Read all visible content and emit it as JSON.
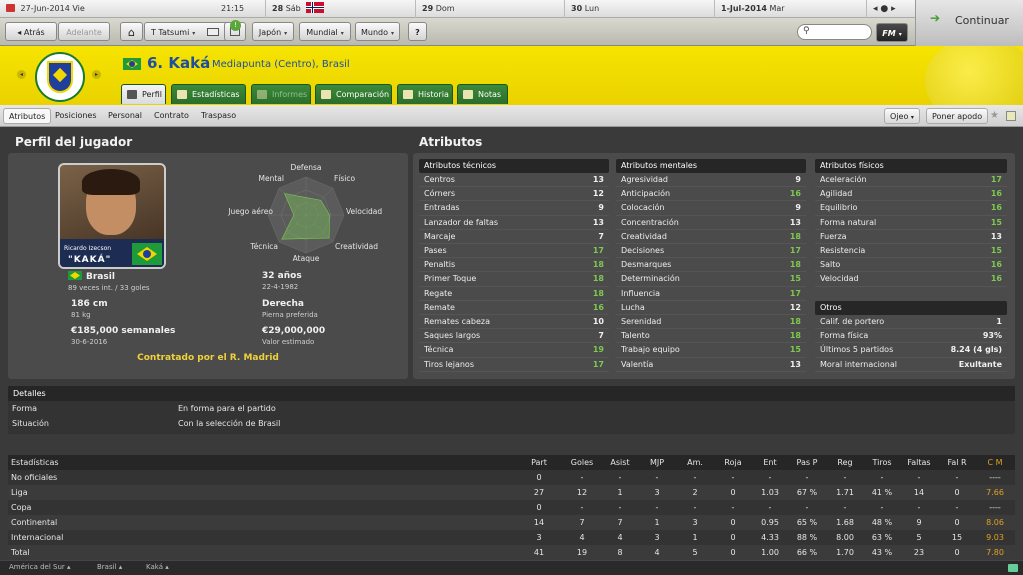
{
  "calendar": {
    "date": "27-Jun-2014",
    "weekday": "Vie",
    "time": "21:15",
    "days": [
      {
        "num": "28",
        "name": "Sáb"
      },
      {
        "num": "29",
        "name": "Dom"
      },
      {
        "num": "30",
        "name": "Lun"
      },
      {
        "num": "1-Jul-2014",
        "name": "Mar"
      }
    ]
  },
  "toolbar": {
    "back": "Atrás",
    "forward": "Adelante",
    "manager": "T Tatsumi",
    "menus": [
      "Japón",
      "Mundial",
      "Mundo"
    ],
    "help": "?",
    "continue": "Continuar",
    "fm": "FM"
  },
  "player": {
    "number_name": "6. Kaká",
    "position": "Mediapunta (Centro), Brasil",
    "card_name": "Ricardo Izecson",
    "card_nick": "\"KAKÁ\""
  },
  "tabs": [
    {
      "label": "Perfil",
      "active": true,
      "disabled": false
    },
    {
      "label": "Estadísticas",
      "active": false,
      "disabled": false
    },
    {
      "label": "Informes",
      "active": false,
      "disabled": true
    },
    {
      "label": "Comparación",
      "active": false,
      "disabled": false
    },
    {
      "label": "Historia",
      "active": false,
      "disabled": false
    },
    {
      "label": "Notas",
      "active": false,
      "disabled": false
    }
  ],
  "subnav": {
    "items": [
      "Atributos",
      "Posiciones",
      "Personal",
      "Contrato",
      "Traspaso"
    ],
    "ojeo": "Ojeo",
    "nickname": "Poner apodo"
  },
  "profile": {
    "title": "Perfil del jugador",
    "radar_labels": {
      "defensa": "Defensa",
      "fisico": "Físico",
      "velocidad": "Velocidad",
      "creatividad": "Creatividad",
      "ataque": "Ataque",
      "tecnica": "Técnica",
      "juego_aereo": "Juego aéreo",
      "mental": "Mental"
    },
    "radar_values": [
      0.46,
      0.55,
      0.62,
      0.86,
      0.62,
      0.9,
      0.32,
      0.8
    ],
    "info": [
      {
        "title": "Brasil",
        "sub": "89 veces int. / 33 goles"
      },
      {
        "title": "32 años",
        "sub": "22-4-1982"
      },
      {
        "title": "186 cm",
        "sub": "81 kg"
      },
      {
        "title": "Derecha",
        "sub": "Pierna preferida"
      },
      {
        "title": "€185,000 semanales",
        "sub": "30-6-2016"
      },
      {
        "title": "€29,000,000",
        "sub": "Valor estimado"
      }
    ],
    "contract": "Contratado por el R. Madrid"
  },
  "attributes": {
    "title": "Atributos",
    "technical": {
      "header": "Atributos técnicos",
      "rows": [
        [
          "Centros",
          13
        ],
        [
          "Córners",
          12
        ],
        [
          "Entradas",
          9
        ],
        [
          "Lanzador de faltas",
          13
        ],
        [
          "Marcaje",
          7
        ],
        [
          "Pases",
          17
        ],
        [
          "Penaltis",
          18
        ],
        [
          "Primer Toque",
          18
        ],
        [
          "Regate",
          18
        ],
        [
          "Remate",
          16
        ],
        [
          "Remates cabeza",
          10
        ],
        [
          "Saques largos",
          7
        ],
        [
          "Técnica",
          19
        ],
        [
          "Tiros lejanos",
          17
        ]
      ]
    },
    "mental": {
      "header": "Atributos mentales",
      "rows": [
        [
          "Agresividad",
          9
        ],
        [
          "Anticipación",
          16
        ],
        [
          "Colocación",
          9
        ],
        [
          "Concentración",
          13
        ],
        [
          "Creatividad",
          18
        ],
        [
          "Decisiones",
          17
        ],
        [
          "Desmarques",
          18
        ],
        [
          "Determinación",
          15
        ],
        [
          "Influencia",
          17
        ],
        [
          "Lucha",
          12
        ],
        [
          "Serenidad",
          18
        ],
        [
          "Talento",
          18
        ],
        [
          "Trabajo equipo",
          15
        ],
        [
          "Valentía",
          13
        ]
      ]
    },
    "physical": {
      "header": "Atributos físicos",
      "rows": [
        [
          "Aceleración",
          17
        ],
        [
          "Agilidad",
          16
        ],
        [
          "Equilibrio",
          16
        ],
        [
          "Forma natural",
          15
        ],
        [
          "Fuerza",
          13
        ],
        [
          "Resistencia",
          15
        ],
        [
          "Salto",
          16
        ],
        [
          "Velocidad",
          16
        ]
      ]
    },
    "others": {
      "header": "Otros",
      "rows": [
        [
          "Calif. de portero",
          "1"
        ],
        [
          "Forma física",
          "93%"
        ],
        [
          "Últimos 5 partidos",
          "8.24 (4 gls)"
        ],
        [
          "Moral internacional",
          "Exultante"
        ]
      ]
    }
  },
  "details": {
    "header": "Detalles",
    "rows": [
      [
        "Forma",
        "En forma para el partido"
      ],
      [
        "Situación",
        "Con la selección de Brasil"
      ]
    ]
  },
  "stats": {
    "headers": [
      "Estadísticas",
      "Part",
      "Goles",
      "Asist",
      "MJP",
      "Am.",
      "Roja",
      "Ent",
      "Pas P",
      "Reg",
      "Tiros",
      "Faltas",
      "Fal R",
      "C M"
    ],
    "rows": [
      [
        "No oficiales",
        "0",
        "-",
        "-",
        "-",
        "-",
        "-",
        "-",
        "-",
        "-",
        "-",
        "-",
        "-",
        "----"
      ],
      [
        "Liga",
        "27",
        "12",
        "1",
        "3",
        "2",
        "0",
        "1.03",
        "67 %",
        "1.71",
        "41 %",
        "14",
        "0",
        "7.66"
      ],
      [
        "Copa",
        "0",
        "-",
        "-",
        "-",
        "-",
        "-",
        "-",
        "-",
        "-",
        "-",
        "-",
        "-",
        "----"
      ],
      [
        "Continental",
        "14",
        "7",
        "7",
        "1",
        "3",
        "0",
        "0.95",
        "65 %",
        "1.68",
        "48 %",
        "9",
        "0",
        "8.06"
      ],
      [
        "Internacional",
        "3",
        "4",
        "4",
        "3",
        "1",
        "0",
        "4.33",
        "88 %",
        "8.00",
        "63 %",
        "5",
        "15",
        "9.03"
      ],
      [
        "Total",
        "41",
        "19",
        "8",
        "4",
        "5",
        "0",
        "1.00",
        "66 %",
        "1.70",
        "43 %",
        "23",
        "0",
        "7.80"
      ]
    ]
  },
  "footer": {
    "crumbs": [
      "América del Sur",
      "Brasil",
      "Kaká"
    ]
  }
}
